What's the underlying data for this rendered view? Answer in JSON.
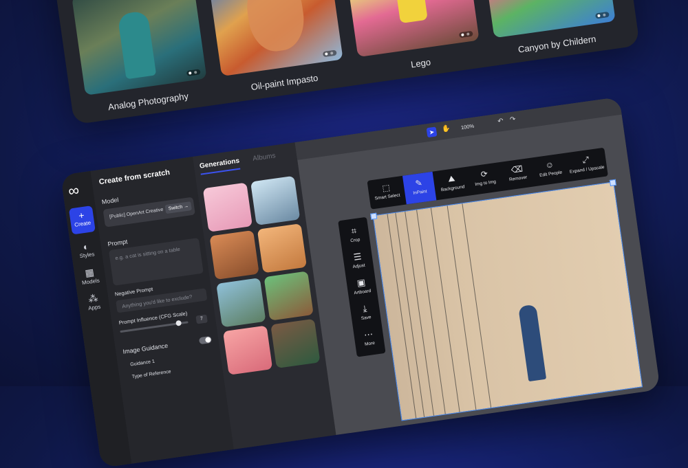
{
  "gallery": {
    "cards": [
      {
        "caption": "Analog Photography"
      },
      {
        "caption": "Oil-paint Impasto"
      },
      {
        "caption": "Lego"
      },
      {
        "caption": "Canyon by Childern"
      }
    ]
  },
  "rail": {
    "items": [
      {
        "label": "Create",
        "icon": "plus-icon"
      },
      {
        "label": "Styles",
        "icon": "palette-icon"
      },
      {
        "label": "Models",
        "icon": "grid-icon"
      },
      {
        "label": "Apps",
        "icon": "apps-icon"
      }
    ]
  },
  "form": {
    "title": "Create from scratch",
    "model_label": "Model",
    "model_name": "[Public] OpenArt Creative",
    "switch_label": "Switch →",
    "prompt_label": "Prompt",
    "prompt_placeholder": "e.g. a cat is sitting on a table",
    "negative_label": "Negative Prompt",
    "negative_placeholder": "Anything you'd like to exclude?",
    "cfg_label": "Prompt Influence (CFG Scale)",
    "cfg_value": "7",
    "image_guidance_label": "Image Guidance",
    "guidance_item": "Guidance 1",
    "reference_label": "Type of Reference"
  },
  "generations": {
    "tab_generations": "Generations",
    "tab_albums": "Albums"
  },
  "canvas": {
    "zoom": "100%",
    "toolbar": [
      {
        "label": "Smart Select",
        "icon": "smart-select-icon"
      },
      {
        "label": "InPaint",
        "icon": "inpaint-brush-icon"
      },
      {
        "label": "Background",
        "icon": "background-icon"
      },
      {
        "label": "Img to Img",
        "icon": "img-to-img-icon"
      },
      {
        "label": "Remover",
        "icon": "eraser-icon"
      },
      {
        "label": "Edit People",
        "icon": "edit-people-icon"
      },
      {
        "label": "Expand / Upscale",
        "icon": "expand-icon"
      }
    ],
    "side_tools": [
      {
        "label": "Crop",
        "icon": "crop-icon"
      },
      {
        "label": "Adjust",
        "icon": "sliders-icon"
      },
      {
        "label": "Artboard",
        "icon": "artboard-icon"
      },
      {
        "label": "Save",
        "icon": "download-icon"
      },
      {
        "label": "More",
        "icon": "more-icon"
      }
    ]
  },
  "colors": {
    "accent": "#2c43e6",
    "selection": "#4b8ef7"
  }
}
